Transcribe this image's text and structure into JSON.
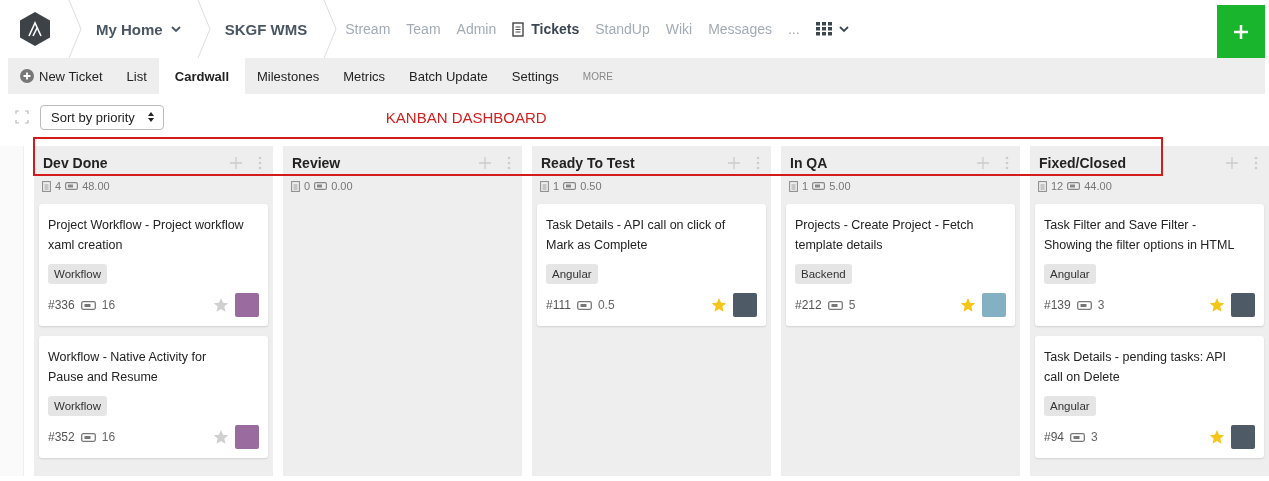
{
  "nav": {
    "crumbs": [
      {
        "label": "My Home",
        "dropdown": true
      },
      {
        "label": "SKGF WMS",
        "dropdown": false
      }
    ],
    "items": [
      {
        "label": "Stream",
        "selected": false,
        "kind": "text"
      },
      {
        "label": "Team",
        "selected": false,
        "kind": "text"
      },
      {
        "label": "Admin",
        "selected": false,
        "kind": "text"
      },
      {
        "label": "Tickets",
        "selected": true,
        "kind": "doc"
      },
      {
        "label": "StandUp",
        "selected": false,
        "kind": "text"
      },
      {
        "label": "Wiki",
        "selected": false,
        "kind": "text"
      },
      {
        "label": "Messages",
        "selected": false,
        "kind": "text"
      },
      {
        "label": "...",
        "selected": false,
        "kind": "text"
      }
    ]
  },
  "subnav": {
    "new_ticket": "New Ticket",
    "tabs": [
      {
        "label": "List",
        "selected": false
      },
      {
        "label": "Cardwall",
        "selected": true
      },
      {
        "label": "Milestones",
        "selected": false
      },
      {
        "label": "Metrics",
        "selected": false
      },
      {
        "label": "Batch Update",
        "selected": false
      },
      {
        "label": "Settings",
        "selected": false
      }
    ],
    "more": "MORE"
  },
  "toolbar": {
    "sort": "Sort by priority"
  },
  "annotation": "KANBAN DASHBOARD",
  "columns": [
    {
      "title": "Dev Done",
      "count": "4",
      "points": "48.00",
      "cards": [
        {
          "title": "Project Workflow - Project workflow xaml creation",
          "tag": "Workflow",
          "id": "#336",
          "estimate": "16",
          "starred": false,
          "avatar": {
            "kind": "purple-face"
          }
        },
        {
          "title": "Workflow - Native Activity for Pause and Resume",
          "tag": "Workflow",
          "id": "#352",
          "estimate": "16",
          "starred": false,
          "avatar": {
            "kind": "purple-face"
          }
        }
      ]
    },
    {
      "title": "Review",
      "count": "0",
      "points": "0.00"
    },
    {
      "title": "Ready To Test",
      "count": "1",
      "points": "0.50",
      "cards": [
        {
          "title": "Task Details - API call on click of Mark as Complete",
          "tag": "Angular",
          "id": "#111",
          "estimate": "0.5",
          "starred": true,
          "avatar": {
            "kind": "photo"
          }
        }
      ]
    },
    {
      "title": "In QA",
      "count": "1",
      "points": "5.00",
      "cards": [
        {
          "title": "Projects - Create Project - Fetch template details",
          "tag": "Backend",
          "id": "#212",
          "estimate": "5",
          "starred": true,
          "avatar": {
            "kind": "teal-face"
          }
        }
      ]
    },
    {
      "title": "Fixed/Closed",
      "count": "12",
      "points": "44.00",
      "cards": [
        {
          "title": "Task Filter and Save Filter - Showing the filter options in HTML",
          "tag": "Angular",
          "id": "#139",
          "estimate": "3",
          "starred": true,
          "avatar": {
            "kind": "photo"
          }
        },
        {
          "title": "Task Details - pending tasks: API call on Delete",
          "tag": "Angular",
          "id": "#94",
          "estimate": "3",
          "starred": true,
          "avatar": {
            "kind": "photo"
          }
        }
      ]
    }
  ]
}
